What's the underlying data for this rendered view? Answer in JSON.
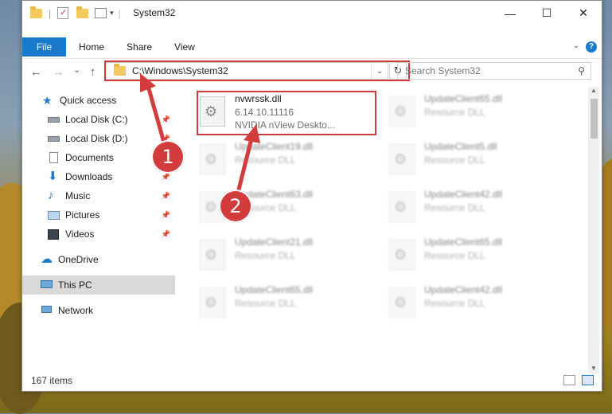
{
  "window": {
    "title": "System32",
    "controls": {
      "minimize": "—",
      "maximize": "☐",
      "close": "✕"
    }
  },
  "ribbon": {
    "tabs": [
      {
        "label": "File"
      },
      {
        "label": "Home"
      },
      {
        "label": "Share"
      },
      {
        "label": "View"
      }
    ],
    "help": "?"
  },
  "navbar": {
    "back": "←",
    "forward": "→",
    "recent": "⌄",
    "up": "↑",
    "address": "C:\\Windows\\System32",
    "refresh": "↻",
    "search_placeholder": "Search System32",
    "search_icon": "⚲"
  },
  "sidebar": {
    "quick_access": "Quick access",
    "items": [
      {
        "label": "Local Disk (C:)",
        "icon": "drive-icon"
      },
      {
        "label": "Local Disk (D:)",
        "icon": "drive-icon"
      },
      {
        "label": "Documents",
        "icon": "documents-icon"
      },
      {
        "label": "Downloads",
        "icon": "downloads-icon"
      },
      {
        "label": "Music",
        "icon": "music-icon"
      },
      {
        "label": "Pictures",
        "icon": "pictures-icon"
      },
      {
        "label": "Videos",
        "icon": "videos-icon"
      }
    ],
    "onedrive": "OneDrive",
    "this_pc": "This PC",
    "network": "Network"
  },
  "files": [
    {
      "name": "nvwrssk.dll",
      "version": "6.14.10.11116",
      "desc": "NVIDIA nView Deskto..."
    },
    {
      "name": "UpdateClient65.dll",
      "desc": "Resource DLL"
    },
    {
      "name": "UpdateClient19.dll",
      "desc": "Resource DLL"
    },
    {
      "name": "UpdateClient5.dll",
      "desc": "Resource DLL"
    },
    {
      "name": "UpdateClient63.dll",
      "desc": "Resource DLL"
    },
    {
      "name": "UpdateClient42.dll",
      "desc": "Resource DLL"
    },
    {
      "name": "UpdateClient21.dll",
      "desc": "Resource DLL"
    },
    {
      "name": "UpdateClient65.dll",
      "desc": "Resource DLL"
    },
    {
      "name": "UpdateClient65.dll",
      "desc": "Resource DLL"
    },
    {
      "name": "UpdateClient42.dll",
      "desc": "Resource DLL"
    }
  ],
  "status": {
    "count": "167 items"
  },
  "annotations": {
    "step1": "1",
    "step2": "2"
  },
  "colors": {
    "accent": "#1979ca",
    "highlight": "#d0393e"
  }
}
